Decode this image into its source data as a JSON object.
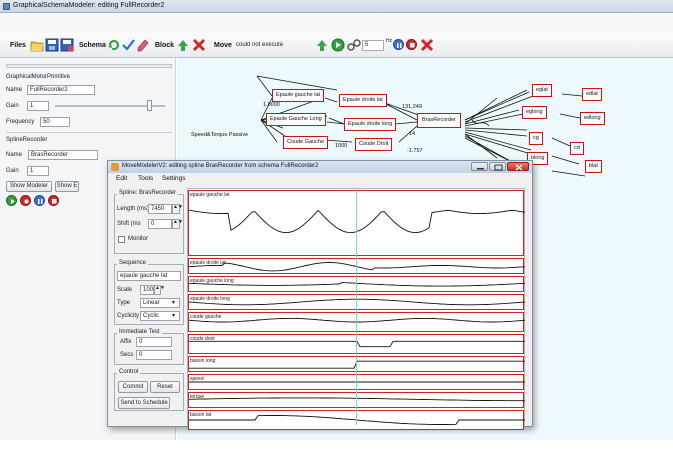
{
  "window": {
    "title": "GraphicalSchemaModeler: editing FullRecorder2"
  },
  "toolbar": {
    "files_label": "Files",
    "schema_label": "Schema",
    "block_label": "Block",
    "move_label": "Move",
    "move_status": "could not execute",
    "hz_value": "5",
    "hz_label": "Hz"
  },
  "left_panel": {
    "motor_section": "GraphicalMotorPrimitive",
    "motor_name_label": "Name",
    "motor_name_value": "FullRecorder2",
    "motor_gain_label": "Gain",
    "motor_gain_value": "1",
    "motor_gain_slider": 0.85,
    "frequency_label": "Frequency",
    "frequency_value": "50",
    "spline_section": "SplineRecorder",
    "spline_name_label": "Name",
    "spline_name_value": "BrasRecorder",
    "spline_gain_label": "Gain",
    "spline_gain_value": "1",
    "show_modeler_label": "Show Modeler",
    "show_e_label": "Show E"
  },
  "schema": {
    "nodes": {
      "epaule_gauche_lat": "Epaule gauche lat",
      "epaule_droite_lat": "Epaule droite lat",
      "epaule_gauche_long": "Epaule Gauche Long",
      "epaule_droite_long": "Epaule droite long",
      "coude_gauche": "Coude Gauche",
      "coude_droit": "Coude Droit",
      "bras_recorder": "BrasRecorder",
      "speed_torque": "Speed&Torque Passive",
      "eglat": "eglat",
      "edlat": "edlat",
      "eglong": "eglong",
      "edlong": "edlong",
      "cg": "cg",
      "cd": "cd",
      "blong": "blong",
      "blat": "blat"
    },
    "edge_labels": {
      "e1": "1.0000",
      "e2": "131.249",
      "e3": "1000",
      "e4": "-1.757",
      "e5": "14"
    }
  },
  "dialog": {
    "title": "MoveModelerV2: editing spline BrasRecorder from schema FullRecorder2",
    "menu": [
      "Edit",
      "Tools",
      "Settings"
    ],
    "spline_group": "Spline: BrasRecorder",
    "length_label": "Length (ms)",
    "length_value": "7450",
    "shift_label": "Shift (ms",
    "shift_value": "0",
    "monitor_label": "Monitor",
    "sequence_group": "Sequence",
    "sequence_value": "epaule gauche lat",
    "scale_label": "Scale",
    "scale_value": "100",
    "type_label": "Type",
    "type_value": "Linear",
    "cyclicity_label": "Cyclicity",
    "cyclicity_value": "Cyclic",
    "immediate_group": "Immediate Test",
    "affix_label": "Affix",
    "affix_value": "0",
    "secs_label": "Secs",
    "secs_value": "0",
    "control_group": "Control",
    "commit_label": "Commit",
    "reset_label": "Reset",
    "send_label": "Send to Schedule",
    "tracks": [
      "epaule gauche lat",
      "epaule droite lat",
      "epaule gauche long",
      "epaule droite long",
      "coude gauche",
      "coude droit",
      "bassin long",
      "speed",
      "torque",
      "bassin lat"
    ]
  },
  "colors": {
    "canvas_bg": "#eef9fd",
    "node_border": "#c81414",
    "play_green": "#27a539",
    "stop_red": "#d9262e",
    "pause_blue": "#3f6fd6",
    "cursor_line": "#7dd4e6"
  }
}
